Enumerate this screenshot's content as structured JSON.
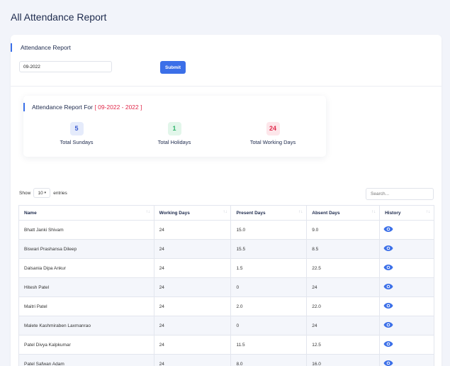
{
  "page": {
    "title": "All Attendance Report"
  },
  "filter": {
    "section_title": "Attendance Report",
    "month_value": "09-2022",
    "submit_label": "Submit"
  },
  "summary": {
    "title_prefix": "Attendance Report For",
    "title_range": "[ 09-2022 - 2022 ]",
    "stats": [
      {
        "value": "5",
        "label": "Total Sundays",
        "color": "#3b5bd0"
      },
      {
        "value": "1",
        "label": "Total Holidays",
        "color": "#2fb36a"
      },
      {
        "value": "24",
        "label": "Total Working Days",
        "color": "#e0284a"
      }
    ]
  },
  "table": {
    "show_label": "Show",
    "entries_value": "10",
    "entries_label": "entries",
    "search_placeholder": "Search...",
    "columns": [
      "Name",
      "Working Days",
      "Present Days",
      "Absent Days",
      "History"
    ],
    "rows": [
      {
        "name": "Bhatt Janki Shivam",
        "working": "24",
        "present": "15.0",
        "absent": "9.0"
      },
      {
        "name": "Biswari Prashansa Dileep",
        "working": "24",
        "present": "15.5",
        "absent": "8.5"
      },
      {
        "name": "Dalsania Dipa Ankur",
        "working": "24",
        "present": "1.5",
        "absent": "22.5"
      },
      {
        "name": "Hitesh Patel",
        "working": "24",
        "present": "0",
        "absent": "24"
      },
      {
        "name": "Maitri Patel",
        "working": "24",
        "present": "2.0",
        "absent": "22.0"
      },
      {
        "name": "Malete Kashmiraben Laxmanrao",
        "working": "24",
        "present": "0",
        "absent": "24"
      },
      {
        "name": "Patel Divya Kalpkumar",
        "working": "24",
        "present": "11.5",
        "absent": "12.5"
      },
      {
        "name": "Patel Safwan Adam",
        "working": "24",
        "present": "8.0",
        "absent": "16.0"
      }
    ]
  },
  "colors": {
    "accent": "#3b6fe8",
    "eye_icon": "#3b6fe8"
  }
}
